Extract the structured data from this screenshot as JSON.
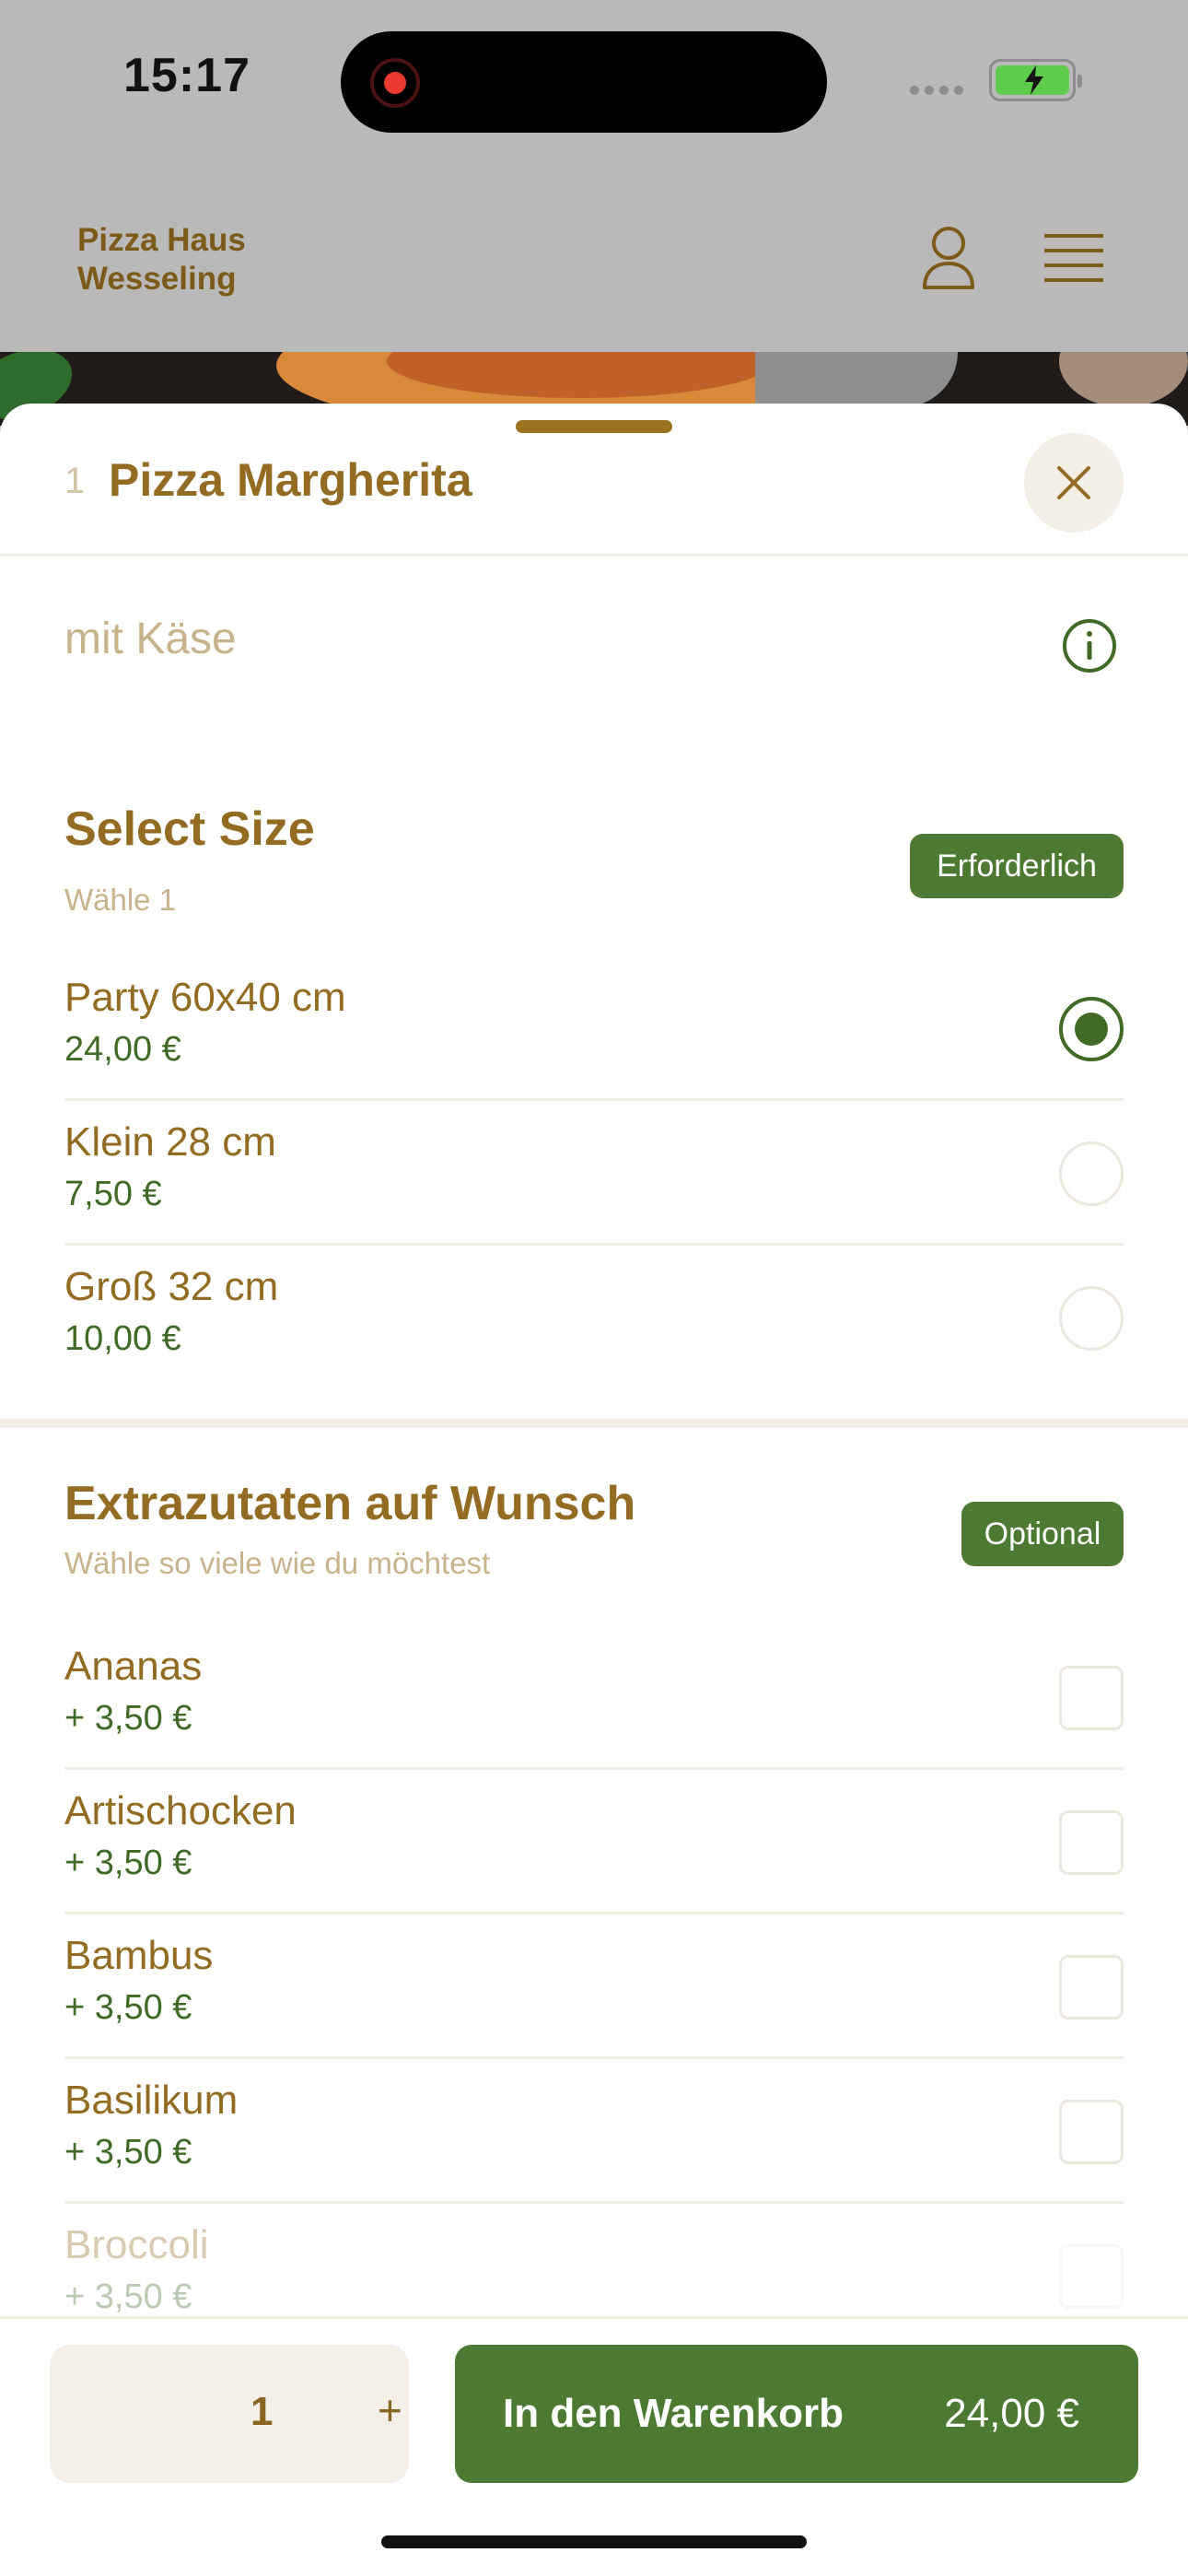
{
  "status_bar": {
    "time": "15:17"
  },
  "header": {
    "brand_line1": "Pizza Haus",
    "brand_line2": "Wesseling"
  },
  "sheet": {
    "quantity_prefix": "1",
    "title": "Pizza Margherita",
    "description": "mit Käse"
  },
  "size_group": {
    "title": "Select Size",
    "subtitle": "Wähle 1",
    "badge": "Erforderlich",
    "options": [
      {
        "name": "Party 60x40 cm",
        "price": "24,00 €",
        "selected": true
      },
      {
        "name": "Klein 28 cm",
        "price": "7,50 €",
        "selected": false
      },
      {
        "name": "Groß 32 cm",
        "price": "10,00 €",
        "selected": false
      }
    ]
  },
  "extras_group": {
    "title": "Extrazutaten auf Wunsch",
    "subtitle": "Wähle so viele wie du möchtest",
    "badge": "Optional",
    "options": [
      {
        "name": "Ananas",
        "price": "+ 3,50 €"
      },
      {
        "name": "Artischocken",
        "price": "+ 3,50 €"
      },
      {
        "name": "Bambus",
        "price": "+ 3,50 €"
      },
      {
        "name": "Basilikum",
        "price": "+ 3,50 €"
      },
      {
        "name": "Broccoli",
        "price": "+ 3,50 €"
      }
    ]
  },
  "bottom_bar": {
    "quantity": "1",
    "plus_label": "+",
    "cart_label": "In den Warenkorb",
    "cart_total": "24,00 €"
  },
  "colors": {
    "brand_brown": "#946b22",
    "accent_green": "#4d7a33",
    "muted_text": "#c9b38c"
  }
}
